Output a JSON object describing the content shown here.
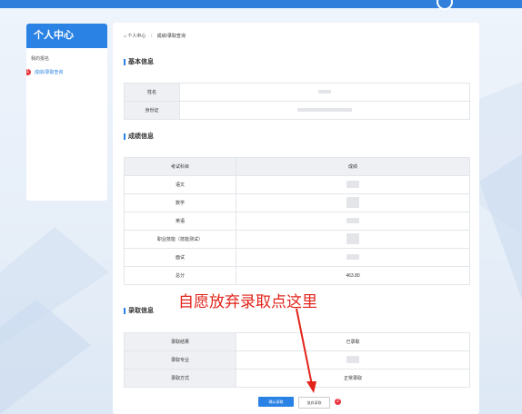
{
  "sidebar": {
    "title": "个人中心",
    "items": [
      {
        "label": "我的报名",
        "active": false
      },
      {
        "label": "成绩/录取查询",
        "active": true,
        "badge": "1"
      }
    ]
  },
  "breadcrumb": {
    "home": "个人中心",
    "current": "成绩/录取查询"
  },
  "basic": {
    "title": "基本信息",
    "rows": [
      {
        "label": "姓名"
      },
      {
        "label": "身份证"
      }
    ]
  },
  "score": {
    "title": "成绩信息",
    "header_subject": "考试科目",
    "header_score": "成绩",
    "rows": [
      {
        "label": "语文",
        "value": ""
      },
      {
        "label": "数学",
        "value": ""
      },
      {
        "label": "英语",
        "value": ""
      },
      {
        "label": "职业技能（技能测试）",
        "value": ""
      },
      {
        "label": "面试",
        "value": ""
      },
      {
        "label": "总分",
        "value": "463.80"
      }
    ]
  },
  "admission": {
    "title": "录取信息",
    "rows": [
      {
        "label": "录取结果",
        "value": "已录取"
      },
      {
        "label": "录取专业",
        "value": ""
      },
      {
        "label": "录取方式",
        "value": "正常录取"
      }
    ]
  },
  "annotation": {
    "text": "自愿放弃录取点这里",
    "badge": "2",
    "color": "#e2231a"
  },
  "buttons": {
    "confirm": "确认录取",
    "abandon": "放弃录取"
  },
  "colors": {
    "primary": "#2a82e4",
    "topbar": "#2f7fdb",
    "badge": "#e8333a"
  }
}
